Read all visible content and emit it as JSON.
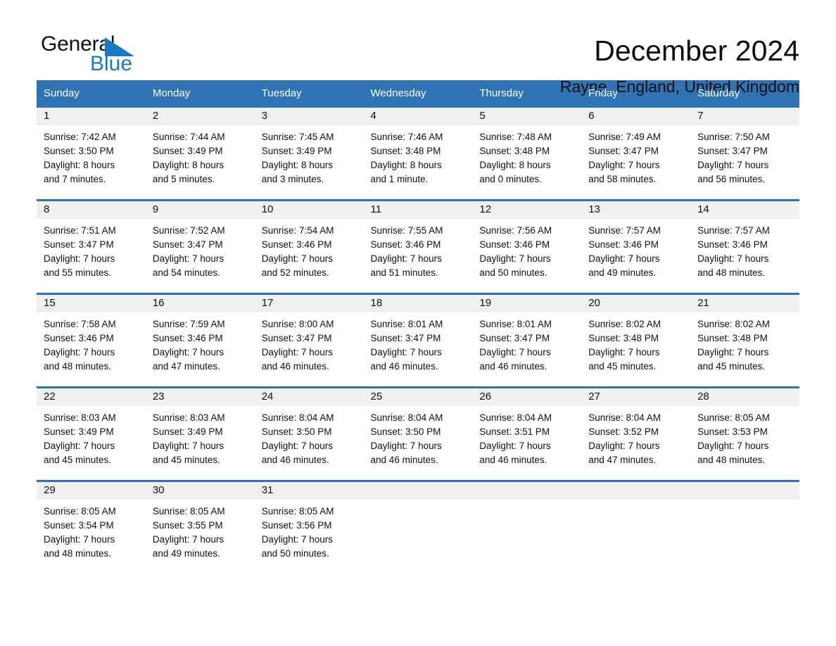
{
  "brand": {
    "name_part1": "General",
    "name_part2": "Blue",
    "accent_color": "#1a79c2"
  },
  "header": {
    "title": "December 2024",
    "location": "Rayne, England, United Kingdom"
  },
  "theme": {
    "header_blue": "#2e74b5",
    "daynum_band": "#f0f0f0"
  },
  "weekday_headers": [
    "Sunday",
    "Monday",
    "Tuesday",
    "Wednesday",
    "Thursday",
    "Friday",
    "Saturday"
  ],
  "labels": {
    "sunrise_prefix": "Sunrise:",
    "sunset_prefix": "Sunset:",
    "daylight_prefix": "Daylight:"
  },
  "weeks": [
    [
      {
        "day": "1",
        "sunrise": "Sunrise: 7:42 AM",
        "sunset": "Sunset: 3:50 PM",
        "daylight_line1": "Daylight: 8 hours",
        "daylight_line2": "and 7 minutes."
      },
      {
        "day": "2",
        "sunrise": "Sunrise: 7:44 AM",
        "sunset": "Sunset: 3:49 PM",
        "daylight_line1": "Daylight: 8 hours",
        "daylight_line2": "and 5 minutes."
      },
      {
        "day": "3",
        "sunrise": "Sunrise: 7:45 AM",
        "sunset": "Sunset: 3:49 PM",
        "daylight_line1": "Daylight: 8 hours",
        "daylight_line2": "and 3 minutes."
      },
      {
        "day": "4",
        "sunrise": "Sunrise: 7:46 AM",
        "sunset": "Sunset: 3:48 PM",
        "daylight_line1": "Daylight: 8 hours",
        "daylight_line2": "and 1 minute."
      },
      {
        "day": "5",
        "sunrise": "Sunrise: 7:48 AM",
        "sunset": "Sunset: 3:48 PM",
        "daylight_line1": "Daylight: 8 hours",
        "daylight_line2": "and 0 minutes."
      },
      {
        "day": "6",
        "sunrise": "Sunrise: 7:49 AM",
        "sunset": "Sunset: 3:47 PM",
        "daylight_line1": "Daylight: 7 hours",
        "daylight_line2": "and 58 minutes."
      },
      {
        "day": "7",
        "sunrise": "Sunrise: 7:50 AM",
        "sunset": "Sunset: 3:47 PM",
        "daylight_line1": "Daylight: 7 hours",
        "daylight_line2": "and 56 minutes."
      }
    ],
    [
      {
        "day": "8",
        "sunrise": "Sunrise: 7:51 AM",
        "sunset": "Sunset: 3:47 PM",
        "daylight_line1": "Daylight: 7 hours",
        "daylight_line2": "and 55 minutes."
      },
      {
        "day": "9",
        "sunrise": "Sunrise: 7:52 AM",
        "sunset": "Sunset: 3:47 PM",
        "daylight_line1": "Daylight: 7 hours",
        "daylight_line2": "and 54 minutes."
      },
      {
        "day": "10",
        "sunrise": "Sunrise: 7:54 AM",
        "sunset": "Sunset: 3:46 PM",
        "daylight_line1": "Daylight: 7 hours",
        "daylight_line2": "and 52 minutes."
      },
      {
        "day": "11",
        "sunrise": "Sunrise: 7:55 AM",
        "sunset": "Sunset: 3:46 PM",
        "daylight_line1": "Daylight: 7 hours",
        "daylight_line2": "and 51 minutes."
      },
      {
        "day": "12",
        "sunrise": "Sunrise: 7:56 AM",
        "sunset": "Sunset: 3:46 PM",
        "daylight_line1": "Daylight: 7 hours",
        "daylight_line2": "and 50 minutes."
      },
      {
        "day": "13",
        "sunrise": "Sunrise: 7:57 AM",
        "sunset": "Sunset: 3:46 PM",
        "daylight_line1": "Daylight: 7 hours",
        "daylight_line2": "and 49 minutes."
      },
      {
        "day": "14",
        "sunrise": "Sunrise: 7:57 AM",
        "sunset": "Sunset: 3:46 PM",
        "daylight_line1": "Daylight: 7 hours",
        "daylight_line2": "and 48 minutes."
      }
    ],
    [
      {
        "day": "15",
        "sunrise": "Sunrise: 7:58 AM",
        "sunset": "Sunset: 3:46 PM",
        "daylight_line1": "Daylight: 7 hours",
        "daylight_line2": "and 48 minutes."
      },
      {
        "day": "16",
        "sunrise": "Sunrise: 7:59 AM",
        "sunset": "Sunset: 3:46 PM",
        "daylight_line1": "Daylight: 7 hours",
        "daylight_line2": "and 47 minutes."
      },
      {
        "day": "17",
        "sunrise": "Sunrise: 8:00 AM",
        "sunset": "Sunset: 3:47 PM",
        "daylight_line1": "Daylight: 7 hours",
        "daylight_line2": "and 46 minutes."
      },
      {
        "day": "18",
        "sunrise": "Sunrise: 8:01 AM",
        "sunset": "Sunset: 3:47 PM",
        "daylight_line1": "Daylight: 7 hours",
        "daylight_line2": "and 46 minutes."
      },
      {
        "day": "19",
        "sunrise": "Sunrise: 8:01 AM",
        "sunset": "Sunset: 3:47 PM",
        "daylight_line1": "Daylight: 7 hours",
        "daylight_line2": "and 46 minutes."
      },
      {
        "day": "20",
        "sunrise": "Sunrise: 8:02 AM",
        "sunset": "Sunset: 3:48 PM",
        "daylight_line1": "Daylight: 7 hours",
        "daylight_line2": "and 45 minutes."
      },
      {
        "day": "21",
        "sunrise": "Sunrise: 8:02 AM",
        "sunset": "Sunset: 3:48 PM",
        "daylight_line1": "Daylight: 7 hours",
        "daylight_line2": "and 45 minutes."
      }
    ],
    [
      {
        "day": "22",
        "sunrise": "Sunrise: 8:03 AM",
        "sunset": "Sunset: 3:49 PM",
        "daylight_line1": "Daylight: 7 hours",
        "daylight_line2": "and 45 minutes."
      },
      {
        "day": "23",
        "sunrise": "Sunrise: 8:03 AM",
        "sunset": "Sunset: 3:49 PM",
        "daylight_line1": "Daylight: 7 hours",
        "daylight_line2": "and 45 minutes."
      },
      {
        "day": "24",
        "sunrise": "Sunrise: 8:04 AM",
        "sunset": "Sunset: 3:50 PM",
        "daylight_line1": "Daylight: 7 hours",
        "daylight_line2": "and 46 minutes."
      },
      {
        "day": "25",
        "sunrise": "Sunrise: 8:04 AM",
        "sunset": "Sunset: 3:50 PM",
        "daylight_line1": "Daylight: 7 hours",
        "daylight_line2": "and 46 minutes."
      },
      {
        "day": "26",
        "sunrise": "Sunrise: 8:04 AM",
        "sunset": "Sunset: 3:51 PM",
        "daylight_line1": "Daylight: 7 hours",
        "daylight_line2": "and 46 minutes."
      },
      {
        "day": "27",
        "sunrise": "Sunrise: 8:04 AM",
        "sunset": "Sunset: 3:52 PM",
        "daylight_line1": "Daylight: 7 hours",
        "daylight_line2": "and 47 minutes."
      },
      {
        "day": "28",
        "sunrise": "Sunrise: 8:05 AM",
        "sunset": "Sunset: 3:53 PM",
        "daylight_line1": "Daylight: 7 hours",
        "daylight_line2": "and 48 minutes."
      }
    ],
    [
      {
        "day": "29",
        "sunrise": "Sunrise: 8:05 AM",
        "sunset": "Sunset: 3:54 PM",
        "daylight_line1": "Daylight: 7 hours",
        "daylight_line2": "and 48 minutes."
      },
      {
        "day": "30",
        "sunrise": "Sunrise: 8:05 AM",
        "sunset": "Sunset: 3:55 PM",
        "daylight_line1": "Daylight: 7 hours",
        "daylight_line2": "and 49 minutes."
      },
      {
        "day": "31",
        "sunrise": "Sunrise: 8:05 AM",
        "sunset": "Sunset: 3:56 PM",
        "daylight_line1": "Daylight: 7 hours",
        "daylight_line2": "and 50 minutes."
      },
      {
        "day": "",
        "sunrise": "",
        "sunset": "",
        "daylight_line1": "",
        "daylight_line2": ""
      },
      {
        "day": "",
        "sunrise": "",
        "sunset": "",
        "daylight_line1": "",
        "daylight_line2": ""
      },
      {
        "day": "",
        "sunrise": "",
        "sunset": "",
        "daylight_line1": "",
        "daylight_line2": ""
      },
      {
        "day": "",
        "sunrise": "",
        "sunset": "",
        "daylight_line1": "",
        "daylight_line2": ""
      }
    ]
  ]
}
